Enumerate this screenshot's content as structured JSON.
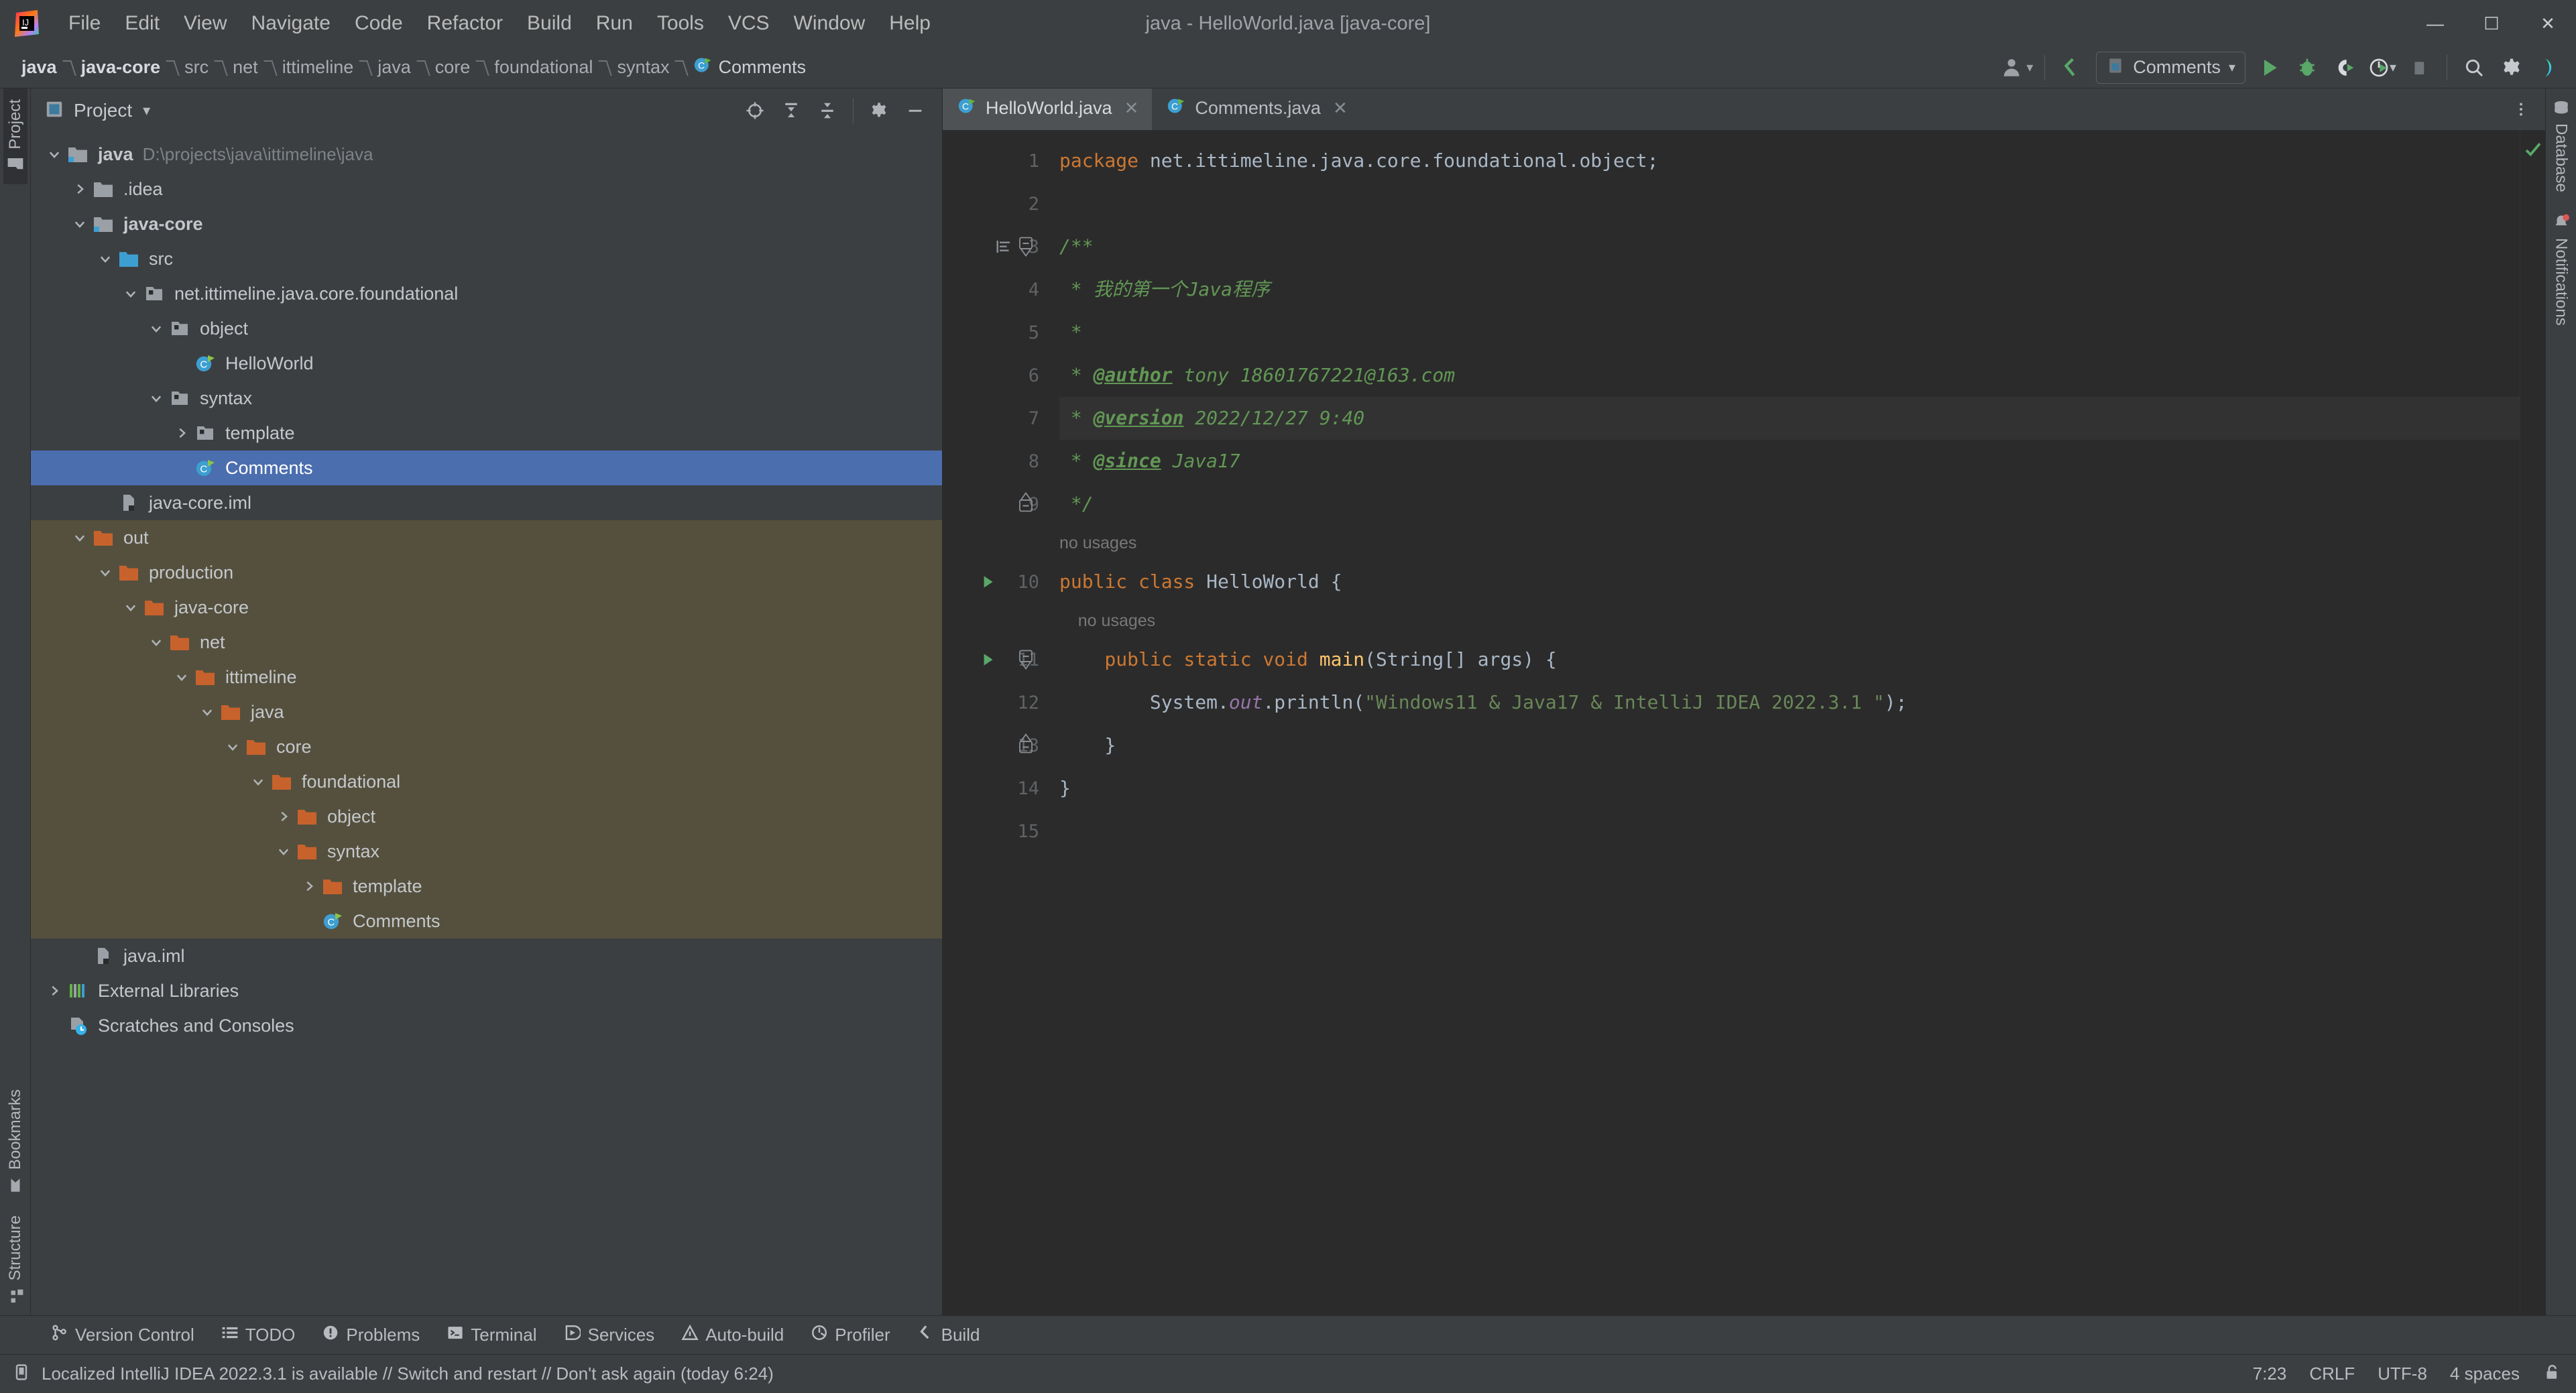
{
  "window": {
    "title": "java - HelloWorld.java [java-core]",
    "minimize": "—",
    "maximize": "☐",
    "close": "✕"
  },
  "menu": [
    "File",
    "Edit",
    "View",
    "Navigate",
    "Code",
    "Refactor",
    "Build",
    "Run",
    "Tools",
    "VCS",
    "Window",
    "Help"
  ],
  "breadcrumb": [
    {
      "label": "java",
      "strong": true
    },
    {
      "label": "java-core",
      "strong": true
    },
    {
      "label": "src"
    },
    {
      "label": "net"
    },
    {
      "label": "ittimeline"
    },
    {
      "label": "java"
    },
    {
      "label": "core"
    },
    {
      "label": "foundational"
    },
    {
      "label": "syntax"
    },
    {
      "label": "Comments",
      "icon": "java-class-icon"
    }
  ],
  "toolbar": {
    "account_icon": "user-account-icon",
    "account_dropdown": "▾",
    "updates_icon": "update-arrow-icon",
    "run_config": "Comments",
    "run_config_caret": "▾",
    "run_icon": "run-icon",
    "debug_icon": "debug-icon",
    "run_coverage_icon": "run-with-coverage-icon",
    "profiler_icon": "profiler-icon",
    "profiler_caret": "▾",
    "stop_icon": "stop-icon",
    "search_icon": "search-everywhere-icon",
    "settings_icon": "settings-gear-icon",
    "ai_icon": "ide-feature-icon"
  },
  "left_rail": [
    {
      "label": "Project",
      "icon": "project-folder-icon",
      "active": true
    },
    {
      "label": "Bookmarks",
      "icon": "bookmark-icon",
      "active": false
    },
    {
      "label": "Structure",
      "icon": "structure-icon",
      "active": false
    }
  ],
  "right_rail": [
    {
      "label": "Database",
      "icon": "database-icon"
    },
    {
      "label": "Notifications",
      "icon": "notifications-bell-icon"
    }
  ],
  "project_panel": {
    "title": "Project",
    "title_caret": "▾",
    "icon": "project-toolwindow-icon",
    "actions": [
      {
        "name": "select-opened-file-icon"
      },
      {
        "name": "expand-all-icon"
      },
      {
        "name": "collapse-all-icon"
      },
      {
        "name": "settings-gear-icon"
      },
      {
        "name": "hide-panel-icon"
      }
    ],
    "tree": [
      {
        "label": "java",
        "path": "D:\\projects\\java\\ittimeline\\java",
        "depth": 0,
        "twisty": "expanded",
        "icon": "module-folder-icon",
        "bold": true
      },
      {
        "label": ".idea",
        "depth": 1,
        "twisty": "collapsed",
        "icon": "folder-icon"
      },
      {
        "label": "java-core",
        "depth": 1,
        "twisty": "expanded",
        "icon": "module-folder-icon",
        "bold": true
      },
      {
        "label": "src",
        "depth": 2,
        "twisty": "expanded",
        "icon": "source-root-icon"
      },
      {
        "label": "net.ittimeline.java.core.foundational",
        "depth": 3,
        "twisty": "expanded",
        "icon": "package-icon"
      },
      {
        "label": "object",
        "depth": 4,
        "twisty": "expanded",
        "icon": "package-icon"
      },
      {
        "label": "HelloWorld",
        "depth": 5,
        "twisty": "none",
        "icon": "java-class-runnable-icon"
      },
      {
        "label": "syntax",
        "depth": 4,
        "twisty": "expanded",
        "icon": "package-icon"
      },
      {
        "label": "template",
        "depth": 5,
        "twisty": "collapsed",
        "icon": "package-icon"
      },
      {
        "label": "Comments",
        "depth": 5,
        "twisty": "none",
        "icon": "java-class-runnable-icon",
        "selected": true
      },
      {
        "label": "java-core.iml",
        "depth": 2,
        "twisty": "none",
        "icon": "iml-file-icon"
      },
      {
        "label": "out",
        "depth": 1,
        "twisty": "expanded",
        "icon": "excluded-folder-icon",
        "excluded": true
      },
      {
        "label": "production",
        "depth": 2,
        "twisty": "expanded",
        "icon": "excluded-folder-icon",
        "excluded": true
      },
      {
        "label": "java-core",
        "depth": 3,
        "twisty": "expanded",
        "icon": "excluded-folder-icon",
        "excluded": true
      },
      {
        "label": "net",
        "depth": 4,
        "twisty": "expanded",
        "icon": "excluded-folder-icon",
        "excluded": true
      },
      {
        "label": "ittimeline",
        "depth": 5,
        "twisty": "expanded",
        "icon": "excluded-folder-icon",
        "excluded": true
      },
      {
        "label": "java",
        "depth": 6,
        "twisty": "expanded",
        "icon": "excluded-folder-icon",
        "excluded": true
      },
      {
        "label": "core",
        "depth": 7,
        "twisty": "expanded",
        "icon": "excluded-folder-icon",
        "excluded": true
      },
      {
        "label": "foundational",
        "depth": 8,
        "twisty": "expanded",
        "icon": "excluded-folder-icon",
        "excluded": true
      },
      {
        "label": "object",
        "depth": 9,
        "twisty": "collapsed",
        "icon": "excluded-folder-icon",
        "excluded": true
      },
      {
        "label": "syntax",
        "depth": 9,
        "twisty": "expanded",
        "icon": "excluded-folder-icon",
        "excluded": true
      },
      {
        "label": "template",
        "depth": 10,
        "twisty": "collapsed",
        "icon": "excluded-folder-icon",
        "excluded": true
      },
      {
        "label": "Comments",
        "depth": 10,
        "twisty": "none",
        "icon": "java-class-runnable-icon",
        "excluded": true
      },
      {
        "label": "java.iml",
        "depth": 1,
        "twisty": "none",
        "icon": "iml-file-icon"
      },
      {
        "label": "External Libraries",
        "depth": 0,
        "twisty": "collapsed",
        "icon": "external-libraries-icon"
      },
      {
        "label": "Scratches and Consoles",
        "depth": 0,
        "twisty": "none",
        "icon": "scratches-icon"
      }
    ]
  },
  "editor": {
    "tabs": [
      {
        "label": "HelloWorld.java",
        "icon": "java-class-runnable-icon",
        "active": true,
        "close": "✕"
      },
      {
        "label": "Comments.java",
        "icon": "java-class-runnable-icon",
        "active": false,
        "close": "✕"
      }
    ],
    "tab_options_icon": "tab-options-icon",
    "inspection_ok_icon": "inspections-ok-check-icon",
    "lines": [
      {
        "n": "1",
        "type": "code",
        "tokens": [
          {
            "t": "package ",
            "c": "kw"
          },
          {
            "t": "net.ittimeline.java.core.foundational.object;",
            "c": "id"
          }
        ]
      },
      {
        "n": "2",
        "type": "code",
        "tokens": []
      },
      {
        "n": "3",
        "type": "code",
        "gutter": "fold-start",
        "gutter_extra": "doc-indent-icon",
        "tokens": [
          {
            "t": "/**",
            "c": "cmt"
          }
        ]
      },
      {
        "n": "4",
        "type": "code",
        "tokens": [
          {
            "t": " * ",
            "c": "cmt"
          },
          {
            "t": "我的第一个Java程序",
            "c": "cmt"
          }
        ]
      },
      {
        "n": "5",
        "type": "code",
        "tokens": [
          {
            "t": " *",
            "c": "cmt"
          }
        ]
      },
      {
        "n": "6",
        "type": "code",
        "tokens": [
          {
            "t": " * ",
            "c": "cmt"
          },
          {
            "t": "@author",
            "c": "cmt-tag"
          },
          {
            "t": " tony 18601767221@163.com",
            "c": "cmt"
          }
        ]
      },
      {
        "n": "7",
        "type": "code",
        "caret": true,
        "tokens": [
          {
            "t": " * ",
            "c": "cmt"
          },
          {
            "t": "@version",
            "c": "cmt-tag"
          },
          {
            "t": " 2022/12/27 9:40",
            "c": "cmt"
          }
        ]
      },
      {
        "n": "8",
        "type": "code",
        "tokens": [
          {
            "t": " * ",
            "c": "cmt"
          },
          {
            "t": "@since",
            "c": "cmt-tag"
          },
          {
            "t": " Java17",
            "c": "cmt"
          }
        ]
      },
      {
        "n": "9",
        "type": "code",
        "gutter": "fold-end",
        "tokens": [
          {
            "t": " */",
            "c": "cmt"
          }
        ]
      },
      {
        "n": "",
        "type": "hint",
        "text": "no usages"
      },
      {
        "n": "10",
        "type": "code",
        "gutter": "run",
        "tokens": [
          {
            "t": "public class ",
            "c": "kw"
          },
          {
            "t": "HelloWorld ",
            "c": "id"
          },
          {
            "t": "{",
            "c": "id"
          }
        ]
      },
      {
        "n": "",
        "type": "hint",
        "text": "    no usages"
      },
      {
        "n": "11",
        "type": "code",
        "gutter": "run",
        "gutter_extra": "fold-start",
        "tokens": [
          {
            "t": "    public static void ",
            "c": "kw"
          },
          {
            "t": "main",
            "c": "fn"
          },
          {
            "t": "(String[] args) {",
            "c": "id"
          }
        ]
      },
      {
        "n": "12",
        "type": "code",
        "tokens": [
          {
            "t": "        System.",
            "c": "id"
          },
          {
            "t": "out",
            "c": "fld"
          },
          {
            "t": ".println(",
            "c": "id"
          },
          {
            "t": "\"Windows11 & Java17 & IntelliJ IDEA 2022.3.1 \"",
            "c": "str"
          },
          {
            "t": ");",
            "c": "id"
          }
        ]
      },
      {
        "n": "13",
        "type": "code",
        "gutter": "fold-end",
        "tokens": [
          {
            "t": "    }",
            "c": "id"
          }
        ]
      },
      {
        "n": "14",
        "type": "code",
        "tokens": [
          {
            "t": "}",
            "c": "id"
          }
        ]
      },
      {
        "n": "15",
        "type": "code",
        "tokens": []
      }
    ]
  },
  "bottom_bar": [
    {
      "label": "Version Control",
      "icon": "version-control-icon"
    },
    {
      "label": "TODO",
      "icon": "todo-list-icon"
    },
    {
      "label": "Problems",
      "icon": "problems-icon"
    },
    {
      "label": "Terminal",
      "icon": "terminal-icon"
    },
    {
      "label": "Services",
      "icon": "services-icon"
    },
    {
      "label": "Auto-build",
      "icon": "auto-build-icon"
    },
    {
      "label": "Profiler",
      "icon": "profiler-icon"
    },
    {
      "label": "Build",
      "icon": "build-hammer-icon"
    }
  ],
  "status_bar": {
    "message_icon": "ide-notification-icon",
    "message": "Localized IntelliJ IDEA 2022.3.1 is available // Switch and restart // Don't ask again (today 6:24)",
    "caret_position": "7:23",
    "line_separator": "CRLF",
    "encoding": "UTF-8",
    "indent": "4 spaces",
    "lock_icon": "unlocked-padlock-icon"
  },
  "colors": {
    "panel_bg": "#3c3f41",
    "editor_bg": "#2b2b2b",
    "selection_blue": "#4b6eaf",
    "excluded_olive": "#55503e",
    "keyword_orange": "#cc7832",
    "string_green": "#6a8759",
    "comment_green": "#629755",
    "method_yellow": "#ffc66d",
    "field_purple": "#9876aa",
    "run_green": "#59a869"
  }
}
